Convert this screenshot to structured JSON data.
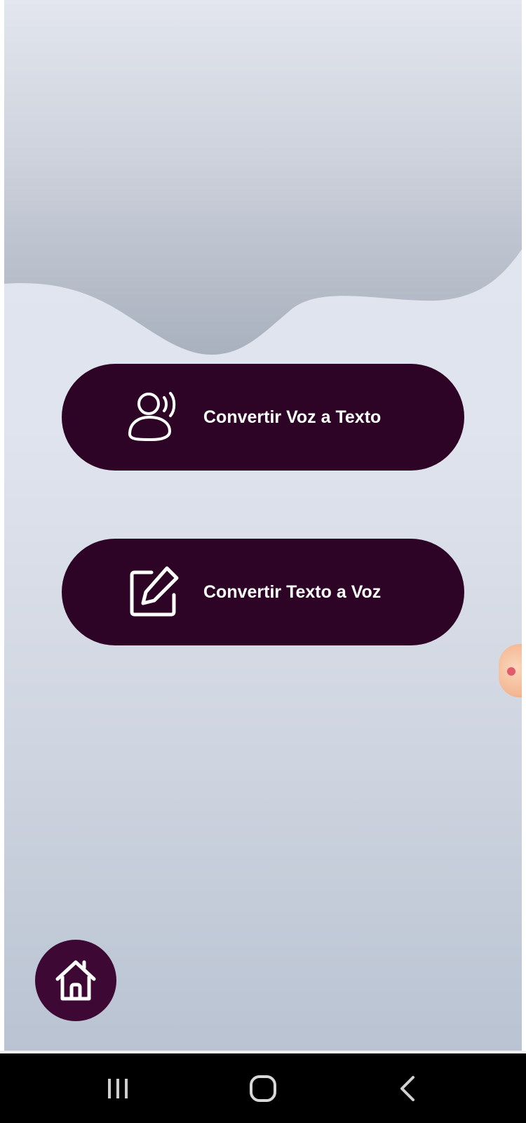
{
  "buttons": {
    "voice_to_text": {
      "label": "Convertir Voz a Texto",
      "icon": "user-voice-icon"
    },
    "text_to_voice": {
      "label": "Convertir Texto a Voz",
      "icon": "edit-icon"
    }
  },
  "home_button": {
    "icon": "home-icon"
  },
  "navigation_bar": {
    "recents_icon": "recents-icon",
    "home_icon": "home-nav-icon",
    "back_icon": "back-icon"
  },
  "colors": {
    "button_bg": "#2d0425",
    "home_bg": "#3d0934",
    "background_top": "#e1e6ef",
    "background_bottom": "#b9c3d2",
    "wave": "#aeb6c3",
    "navbar": "#000000"
  }
}
